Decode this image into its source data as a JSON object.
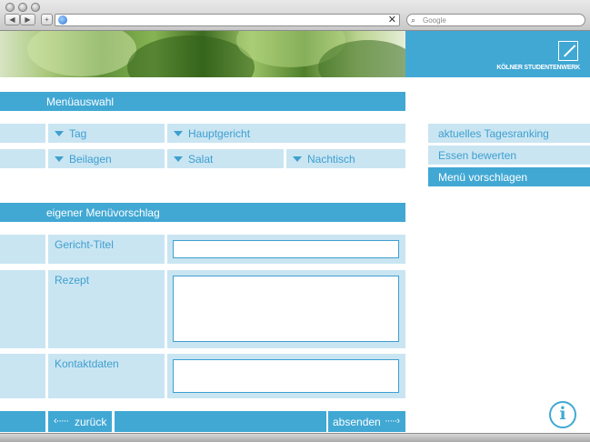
{
  "browser": {
    "search_placeholder": "Google",
    "back_glyph": "◀",
    "forward_glyph": "▶",
    "add_glyph": "+",
    "close_glyph": "✕",
    "search_glyph": "⌕"
  },
  "brand": {
    "name": "KÖLNER STUDENTENWERK",
    "color": "#41a8d4"
  },
  "menu_selection": {
    "title": "Menüauswahl",
    "dropdowns": {
      "tag": "Tag",
      "hauptgericht": "Hauptgericht",
      "beilagen": "Beilagen",
      "salat": "Salat",
      "nachtisch": "Nachtisch"
    }
  },
  "proposal": {
    "title": "eigener Menüvorschlag",
    "fields": {
      "gericht_titel": {
        "label": "Gericht-Titel",
        "value": ""
      },
      "rezept": {
        "label": "Rezept",
        "value": ""
      },
      "kontaktdaten": {
        "label": "Kontaktdaten",
        "value": ""
      }
    }
  },
  "sidebar": {
    "items": [
      {
        "label": "aktuelles Tagesranking"
      },
      {
        "label": "Essen bewerten"
      },
      {
        "label": "Menü vorschlagen",
        "active": true
      }
    ]
  },
  "footer": {
    "back_label": "zurück",
    "send_label": "absenden",
    "arrow_left": "‹·····",
    "arrow_right": "·····›",
    "info_glyph": "i"
  },
  "colors": {
    "accent": "#41a8d4",
    "light": "#c9e5f2",
    "text": "#3e9fd0"
  }
}
